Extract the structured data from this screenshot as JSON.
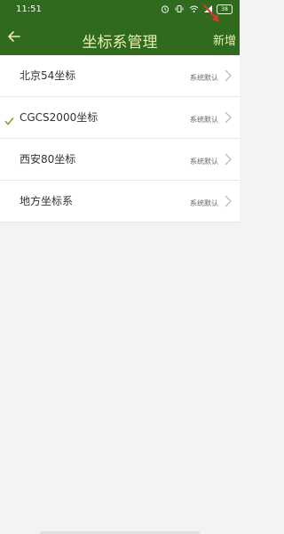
{
  "status_bar": {
    "time": "11:51",
    "battery": "38",
    "icons": [
      "alarm-icon",
      "vibrate-icon",
      "wifi-icon",
      "signal-icon",
      "battery-icon"
    ]
  },
  "header": {
    "title": "坐标系管理",
    "add_label": "新增",
    "back_icon": "back-arrow-icon"
  },
  "colors": {
    "header_bg": "#2f6a1f",
    "header_text": "#e8f0b0",
    "check": "#8aa032",
    "annotation_arrow": "#d63a2c"
  },
  "list": {
    "items": [
      {
        "label": "北京54坐标",
        "tag": "系统默认",
        "selected": false
      },
      {
        "label": "CGCS2000坐标",
        "tag": "系统默认",
        "selected": true
      },
      {
        "label": "西安80坐标",
        "tag": "系统默认",
        "selected": false
      },
      {
        "label": "地方坐标系",
        "tag": "系统默认",
        "selected": false
      }
    ]
  }
}
